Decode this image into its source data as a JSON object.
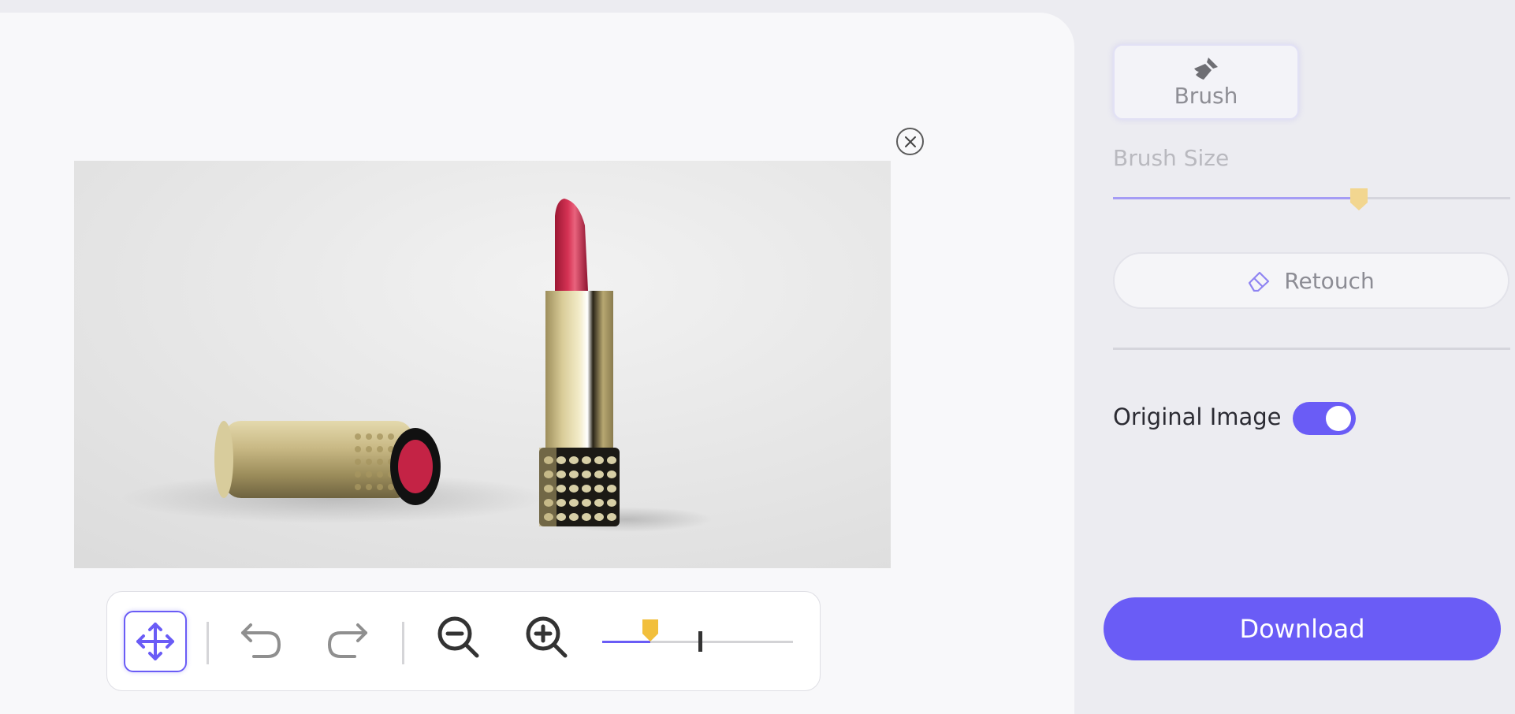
{
  "sidebar": {
    "brush_tab_label": "Brush",
    "brush_size_label": "Brush Size",
    "brush_size_fraction": 0.62,
    "retouch_label": "Retouch",
    "original_image_label": "Original Image",
    "original_image_on": true,
    "download_label": "Download"
  },
  "toolbar": {
    "zoom_fraction": 0.25,
    "tools": [
      "move-icon",
      "undo-icon",
      "redo-icon",
      "zoom-out-icon",
      "zoom-in-icon"
    ]
  },
  "colors": {
    "accent": "#6a5cf6",
    "thumb_yellow": "#f2bf3c",
    "thumb_pale": "#f2d690",
    "lipstick_red": "#c42345",
    "gold": "#c8b67c"
  },
  "icons": {
    "close": "close-icon",
    "brush": "brush-icon",
    "retouch": "eraser-icon"
  }
}
